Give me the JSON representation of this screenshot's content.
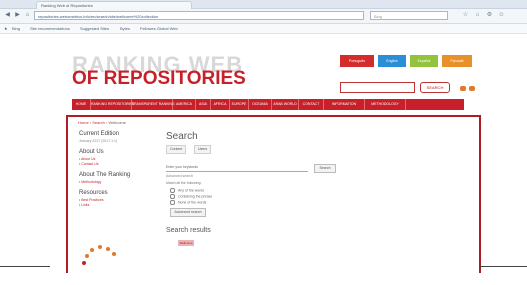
{
  "browser": {
    "tab_title": "Ranking Web of Repositories",
    "url": "repositories.webometrics.info/en/search/site/wellcome%20collection",
    "search_placeholder": "Bing",
    "favorites": [
      "Bing",
      "Site recommendations",
      "Suggested Sites",
      "Bytes",
      "Fellowes Global Web"
    ]
  },
  "header": {
    "logo_line1": "RANKING WEB",
    "logo_line2": "OF REPOSITORIES",
    "languages": [
      {
        "label": "Português",
        "color": "#d42b2b"
      },
      {
        "label": "English",
        "color": "#2a8fd6"
      },
      {
        "label": "Español",
        "color": "#93c23d"
      },
      {
        "label": "Русский",
        "color": "#e8902a"
      }
    ],
    "search_button": "SEARCH"
  },
  "menu": [
    "HOME",
    "RANKING REPOSITORIES",
    "TRANSPARENT RANKING",
    "AMERICA",
    "ASIA",
    "AFRICA",
    "EUROPE",
    "OCEANIA",
    "ARAB WORLD",
    "CONTACT",
    "INFORMATION",
    "METHODOLOGY"
  ],
  "breadcrumb": [
    "Home",
    "Search",
    "Wellcome"
  ],
  "sidebar": {
    "current_edition": "Current Edition",
    "edition_date": "January 2017 (2017.1.1)",
    "about_us": "About Us",
    "about_links": [
      "About Us",
      "Contact Us"
    ],
    "about_ranking": "About The Ranking",
    "ranking_links": [
      "Methodology"
    ],
    "resources": "Resources",
    "resource_links": [
      "Best Practices",
      "Links"
    ]
  },
  "main": {
    "title": "Search",
    "tab_content": "Content",
    "tab_users": "Users",
    "query": "Enter your keywords",
    "search_btn": "Search",
    "adv_link": "Advanced search",
    "type_label": "Match all the following:",
    "options": [
      "Any of the words",
      "Containing the phrase",
      "None of the words"
    ],
    "adv_button": "Advanced search",
    "results_title": "Search results",
    "result_badge": "Wellcome"
  }
}
